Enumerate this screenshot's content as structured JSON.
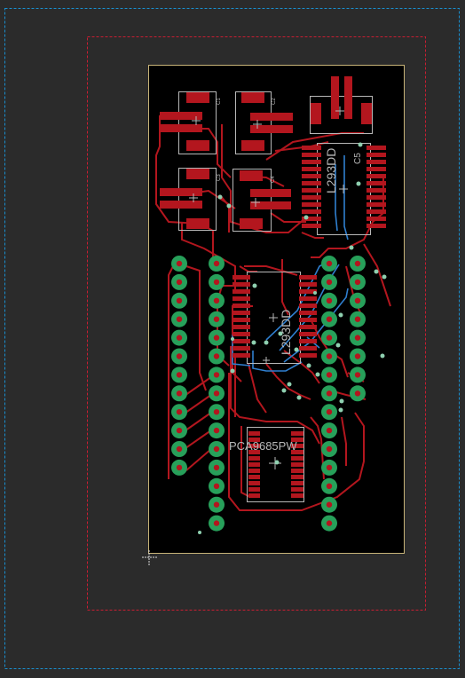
{
  "board": {
    "labels": {
      "driver_top": "L293DD",
      "driver_mid": "L293DD",
      "pwm_chip": "PCA9685PW",
      "c1": "C1",
      "c2": "C2",
      "c3": "C3",
      "c4": "C4",
      "c5": "C5"
    }
  },
  "colors": {
    "canvas": "#2b2b2b",
    "board_fill": "#000000",
    "board_outline": "#c8b478",
    "top_copper": "#b3161e",
    "bottom_copper": "#2f7fcf",
    "pad_green": "#27a05a",
    "silkscreen": "#b8b8b8",
    "outer_frame": "#1a8fcf",
    "inner_frame": "#c81e32"
  }
}
